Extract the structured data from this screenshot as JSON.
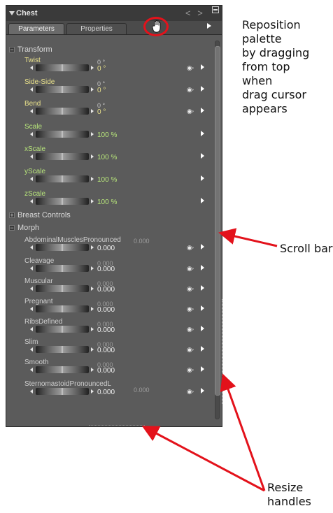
{
  "palette": {
    "title": "Chest",
    "tabs": [
      {
        "label": "Parameters",
        "active": true
      },
      {
        "label": "Properties",
        "active": false
      }
    ],
    "nav_arrows": "< >"
  },
  "sections": {
    "transform": {
      "label": "Transform",
      "expand_symbol": "−"
    },
    "breast_controls": {
      "label": "Breast Controls",
      "expand_symbol": "+"
    },
    "morph": {
      "label": "Morph",
      "expand_symbol": "−"
    }
  },
  "transform_params": [
    {
      "name": "Twist",
      "value_top": "0 °",
      "value": "0 °"
    },
    {
      "name": "Side-Side",
      "value_top": "0 °",
      "value": "0 °"
    },
    {
      "name": "Bend",
      "value_top": "0 °",
      "value": "0 °"
    },
    {
      "name": "Scale",
      "value": "100 %"
    },
    {
      "name": "xScale",
      "value": "100 %"
    },
    {
      "name": "yScale",
      "value": "100 %"
    },
    {
      "name": "zScale",
      "value": "100 %"
    }
  ],
  "morph_params": [
    {
      "name": "AbdominalMusclesPronounced",
      "value_side": "0.000",
      "value": "0.000"
    },
    {
      "name": "Cleavage",
      "value_top": "0.000",
      "value": "0.000"
    },
    {
      "name": "Muscular",
      "value_top": "0.000",
      "value": "0.000"
    },
    {
      "name": "Pregnant",
      "value_top": "0.000",
      "value": "0.000"
    },
    {
      "name": "RibsDefined",
      "value_top": "0.000",
      "value": "0.000"
    },
    {
      "name": "Slim",
      "value_top": "0.000",
      "value": "0.000"
    },
    {
      "name": "Smooth",
      "value_top": "0.000",
      "value": "0.000"
    },
    {
      "name": "SternomastoidPronouncedL",
      "value_side": "0.000",
      "value": "0.000"
    }
  ],
  "annotations": {
    "reposition": [
      "Reposition",
      "palette",
      "by dragging",
      "from top",
      "when",
      "drag cursor",
      "appears"
    ],
    "scroll_bar": "Scroll bar",
    "resize": [
      "Resize",
      "handles"
    ]
  },
  "colors": {
    "panel_bg": "#5b5b5b",
    "title_bg": "#3a3a3a",
    "transform_label": "#e8e08a",
    "scale_label": "#b7e57a",
    "annotation_red": "#e3121b"
  },
  "icons": [
    "hand-cursor-icon",
    "palette-menu-icon",
    "keyframe-dial-icon",
    "expand-arrow-icon"
  ]
}
